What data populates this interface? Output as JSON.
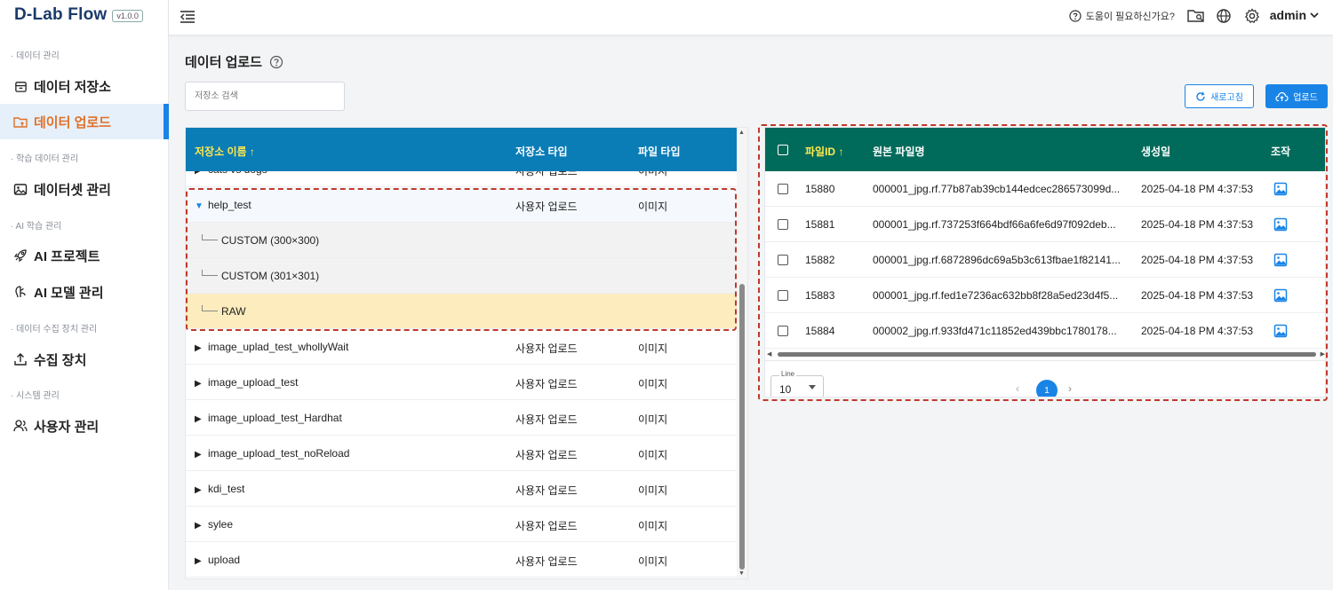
{
  "app": {
    "logo": "D-Lab Flow",
    "version": "v1.0.0"
  },
  "sidebar": {
    "sections": [
      {
        "label": "· 데이터 관리"
      },
      {
        "label": "· 학습 데이터 관리"
      },
      {
        "label": "· AI 학습 관리"
      },
      {
        "label": "· 데이터 수집 장치 관리"
      },
      {
        "label": "· 시스템 관리"
      }
    ],
    "items": [
      {
        "label": "데이터 저장소",
        "icon": "storage-icon"
      },
      {
        "label": "데이터 업로드",
        "icon": "folder-upload-icon",
        "active": true
      },
      {
        "label": "데이터셋 관리",
        "icon": "image-icon"
      },
      {
        "label": "AI 프로젝트",
        "icon": "rocket-icon"
      },
      {
        "label": "AI 모델 관리",
        "icon": "brain-icon"
      },
      {
        "label": "수집 장치",
        "icon": "upload-icon"
      },
      {
        "label": "사용자 관리",
        "icon": "users-icon"
      }
    ]
  },
  "topbar": {
    "help_text": "도움이 필요하신가요?",
    "user": "admin"
  },
  "page": {
    "title": "데이터 업로드",
    "search": {
      "placeholder": "저장소 검색",
      "value": ""
    },
    "refresh_label": "새로고침",
    "upload_label": "업로드"
  },
  "storage_table": {
    "headers": {
      "name": "저장소 이름 ↑",
      "type": "저장소 타입",
      "file_type": "파일 타입"
    },
    "rows": [
      {
        "name": "cats vs dogs",
        "type": "사용자 업로드",
        "file_type": "이미지",
        "kind": "collapsed"
      },
      {
        "name": "help_test",
        "type": "사용자 업로드",
        "file_type": "이미지",
        "kind": "expanded"
      },
      {
        "name": "CUSTOM (300×300)",
        "type": "",
        "file_type": "",
        "kind": "child"
      },
      {
        "name": "CUSTOM (301×301)",
        "type": "",
        "file_type": "",
        "kind": "child"
      },
      {
        "name": "RAW",
        "type": "",
        "file_type": "",
        "kind": "selected"
      },
      {
        "name": "image_uplad_test_whollyWait",
        "type": "사용자 업로드",
        "file_type": "이미지",
        "kind": "collapsed"
      },
      {
        "name": "image_upload_test",
        "type": "사용자 업로드",
        "file_type": "이미지",
        "kind": "collapsed"
      },
      {
        "name": "image_upload_test_Hardhat",
        "type": "사용자 업로드",
        "file_type": "이미지",
        "kind": "collapsed"
      },
      {
        "name": "image_upload_test_noReload",
        "type": "사용자 업로드",
        "file_type": "이미지",
        "kind": "collapsed"
      },
      {
        "name": "kdi_test",
        "type": "사용자 업로드",
        "file_type": "이미지",
        "kind": "collapsed"
      },
      {
        "name": "sylee",
        "type": "사용자 업로드",
        "file_type": "이미지",
        "kind": "collapsed"
      },
      {
        "name": "upload",
        "type": "사용자 업로드",
        "file_type": "이미지",
        "kind": "collapsed"
      }
    ]
  },
  "file_table": {
    "headers": {
      "file_id": "파일ID ↑",
      "name": "원본 파일명",
      "created": "생성일",
      "action": "조작"
    },
    "rows": [
      {
        "id": "15880",
        "name": "000001_jpg.rf.77b87ab39cb144edcec286573099d...",
        "created": "2025-04-18 PM 4:37:53"
      },
      {
        "id": "15881",
        "name": "000001_jpg.rf.737253f664bdf66a6fe6d97f092deb...",
        "created": "2025-04-18 PM 4:37:53"
      },
      {
        "id": "15882",
        "name": "000001_jpg.rf.6872896dc69a5b3c613fbae1f82141...",
        "created": "2025-04-18 PM 4:37:53"
      },
      {
        "id": "15883",
        "name": "000001_jpg.rf.fed1e7236ac632bb8f28a5ed23d4f5...",
        "created": "2025-04-18 PM 4:37:53"
      },
      {
        "id": "15884",
        "name": "000002_jpg.rf.933fd471c11852ed439bbc1780178...",
        "created": "2025-04-18 PM 4:37:53"
      }
    ],
    "pager": {
      "line_label": "Line",
      "line_value": "10",
      "current_page": "1"
    }
  },
  "colors": {
    "accent": "#1a84e6",
    "active_nav": "#e07028",
    "storage_header": "#0a7cb6",
    "file_header": "#006b5b",
    "highlight_dash": "#c0392b"
  }
}
